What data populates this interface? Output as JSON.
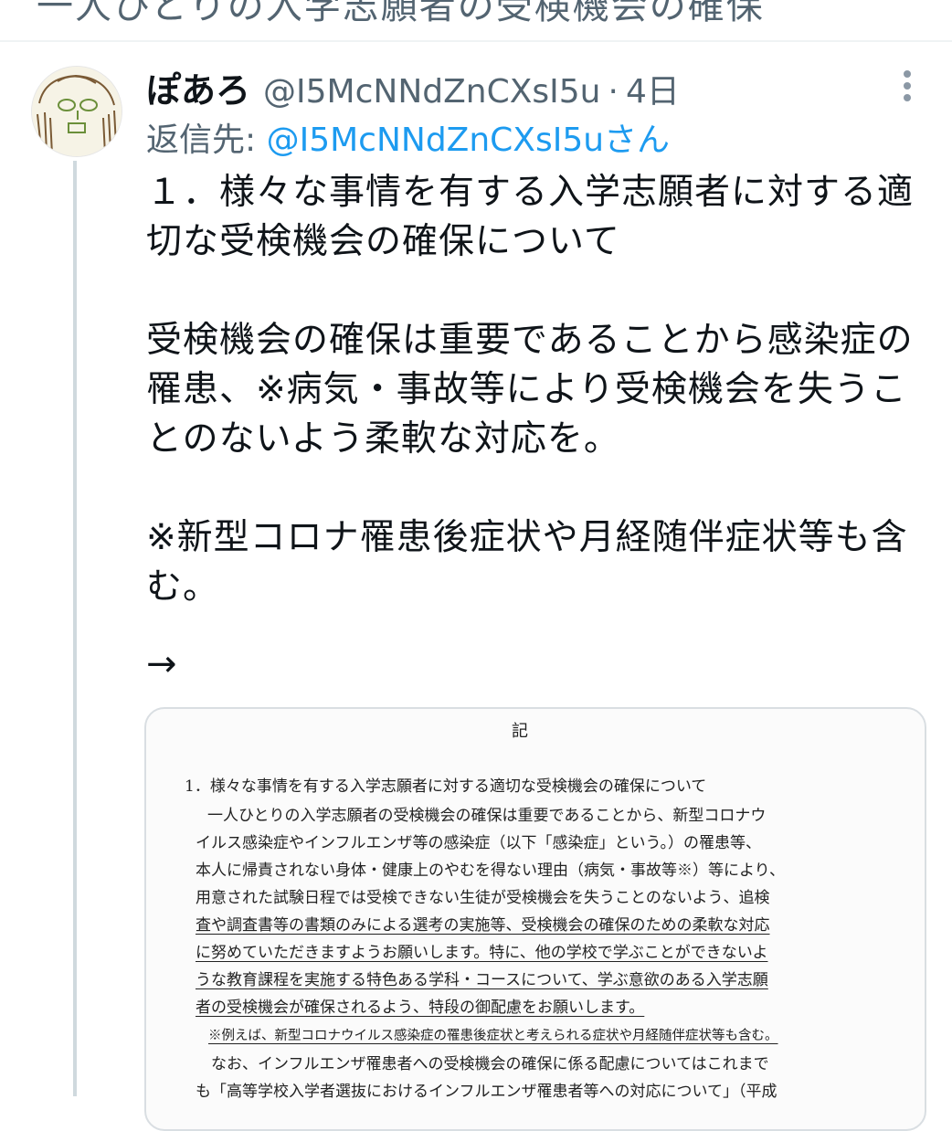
{
  "previous_tweet": {
    "fragment": "一人ひとりの入学志願者の受検機会の確保"
  },
  "tweet": {
    "display_name": "ぽあろ",
    "handle": "@I5McNNdZnCXsI5u",
    "separator": "·",
    "time": "4日",
    "reply_label": "返信先: ",
    "reply_user": "@I5McNNdZnCXsI5uさん",
    "text_lines": [
      "１．様々な事情を有する入学志願者に対する適",
      "切な受検機会の確保について",
      "",
      "受検機会の確保は重要であることから感染症の",
      "罹患、※病気・事故等により受検機会を失うこ",
      "とのないよう柔軟な対応を。",
      "",
      "※新型コロナ罹患後症状や月経随伴症状等も含",
      "む。"
    ],
    "arrow": "→"
  },
  "attached_image": {
    "heading": "記",
    "lines": [
      "1．様々な事情を有する入学志願者に対する適切な受検機会の確保について",
      "　一人ひとりの入学志願者の受検機会の確保は重要であることから、新型コロナウ",
      "イルス感染症やインフルエンザ等の感染症（以下「感染症」という。）の罹患等、",
      "本人に帰責されない身体・健康上のやむを得ない理由（病気・事故等※）等により、",
      "用意された試験日程では受検できない生徒が受検機会を失うことのないよう、追検",
      "査や調査書等の書類のみによる選考の実施等、受検機会の確保のための柔軟な対応",
      "に努めていただきますようお願いします。特に、他の学校で学ぶことができないよ",
      "うな教育課程を実施する特色ある学科・コースについて、学ぶ意欲のある入学志願",
      "者の受検機会が確保されるよう、特段の御配慮をお願いします。",
      "※例えば、新型コロナウイルス感染症の罹患後症状と考えられる症状や月経随伴症状等も含む。",
      "　なお、インフルエンザ罹患者への受検機会の確保に係る配慮についてはこれまで",
      "も「高等学校入学者選抜におけるインフルエンザ罹患者等への対応について」（平成"
    ]
  }
}
